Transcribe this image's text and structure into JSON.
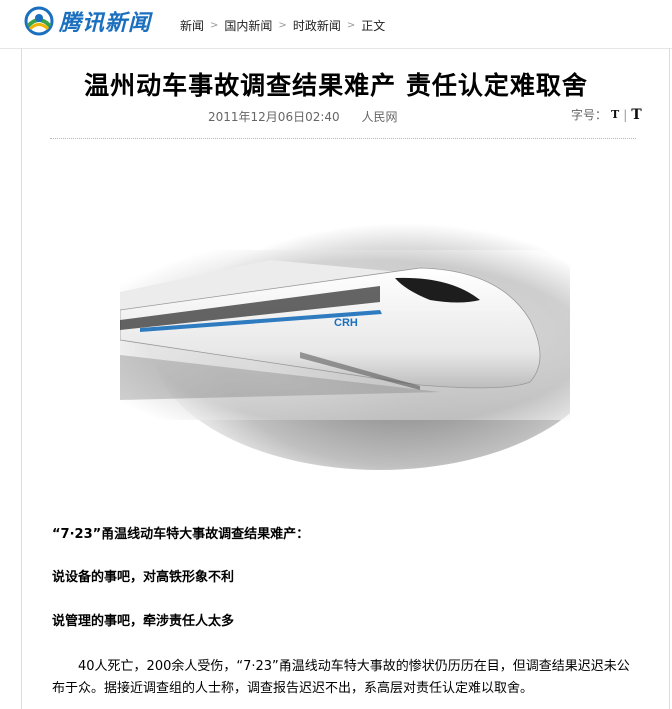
{
  "header": {
    "logo_text": "腾讯新闻",
    "breadcrumb": [
      "新闻",
      "国内新闻",
      "时政新闻",
      "正文"
    ]
  },
  "article": {
    "title": "温州动车事故调查结果难产 责任认定难取舍",
    "datetime": "2011年12月06日02:40",
    "source": "人民网",
    "font_size_label": "字号：",
    "font_small": "T",
    "font_large": "T",
    "image_text": "CRH",
    "paragraphs": [
      "“7·23”甬温线动车特大事故调查结果难产：",
      "说设备的事吧，对高铁形象不利",
      "说管理的事吧，牵涉责任人太多",
      "40人死亡，200余人受伤，“7·23”甬温线动车特大事故的惨状仍历历在目，但调查结果迟迟未公布于众。据接近调查组的人士称，调查报告迟迟不出，系高层对责任认定难以取舍。"
    ]
  },
  "colors": {
    "brand_blue": "#1a6fbf",
    "logo_green": "#3aa34a",
    "logo_yellow": "#f0b400"
  }
}
